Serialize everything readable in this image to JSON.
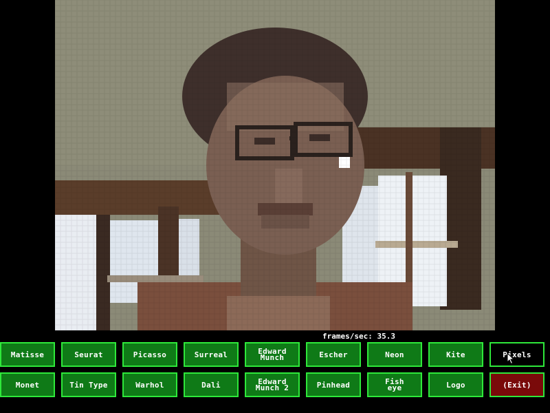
{
  "status": {
    "fps_label": "frames/sec:",
    "fps_value": "35.3"
  },
  "camera": {
    "content": "webcam-feed-pixelated"
  },
  "filters": {
    "row1": [
      {
        "label": "Matisse"
      },
      {
        "label": "Seurat"
      },
      {
        "label": "Picasso"
      },
      {
        "label": "Surreal"
      },
      {
        "label": "Edward\nMunch"
      },
      {
        "label": "Escher"
      },
      {
        "label": "Neon"
      },
      {
        "label": "Kite"
      },
      {
        "label": "Pixels",
        "selected": true
      }
    ],
    "row2": [
      {
        "label": "Monet"
      },
      {
        "label": "Tin Type"
      },
      {
        "label": "Warhol"
      },
      {
        "label": "Dali"
      },
      {
        "label": "Edward\nMunch 2"
      },
      {
        "label": "Pinhead"
      },
      {
        "label": "Fish\neye"
      },
      {
        "label": "Logo"
      },
      {
        "label": "(Exit)"
      }
    ]
  },
  "colors": {
    "button_fill": "#0f7a17",
    "button_border": "#2ee83a",
    "selected_fill": "#000000",
    "exit_fill": "#7a0a0a",
    "text": "#ffffff"
  }
}
